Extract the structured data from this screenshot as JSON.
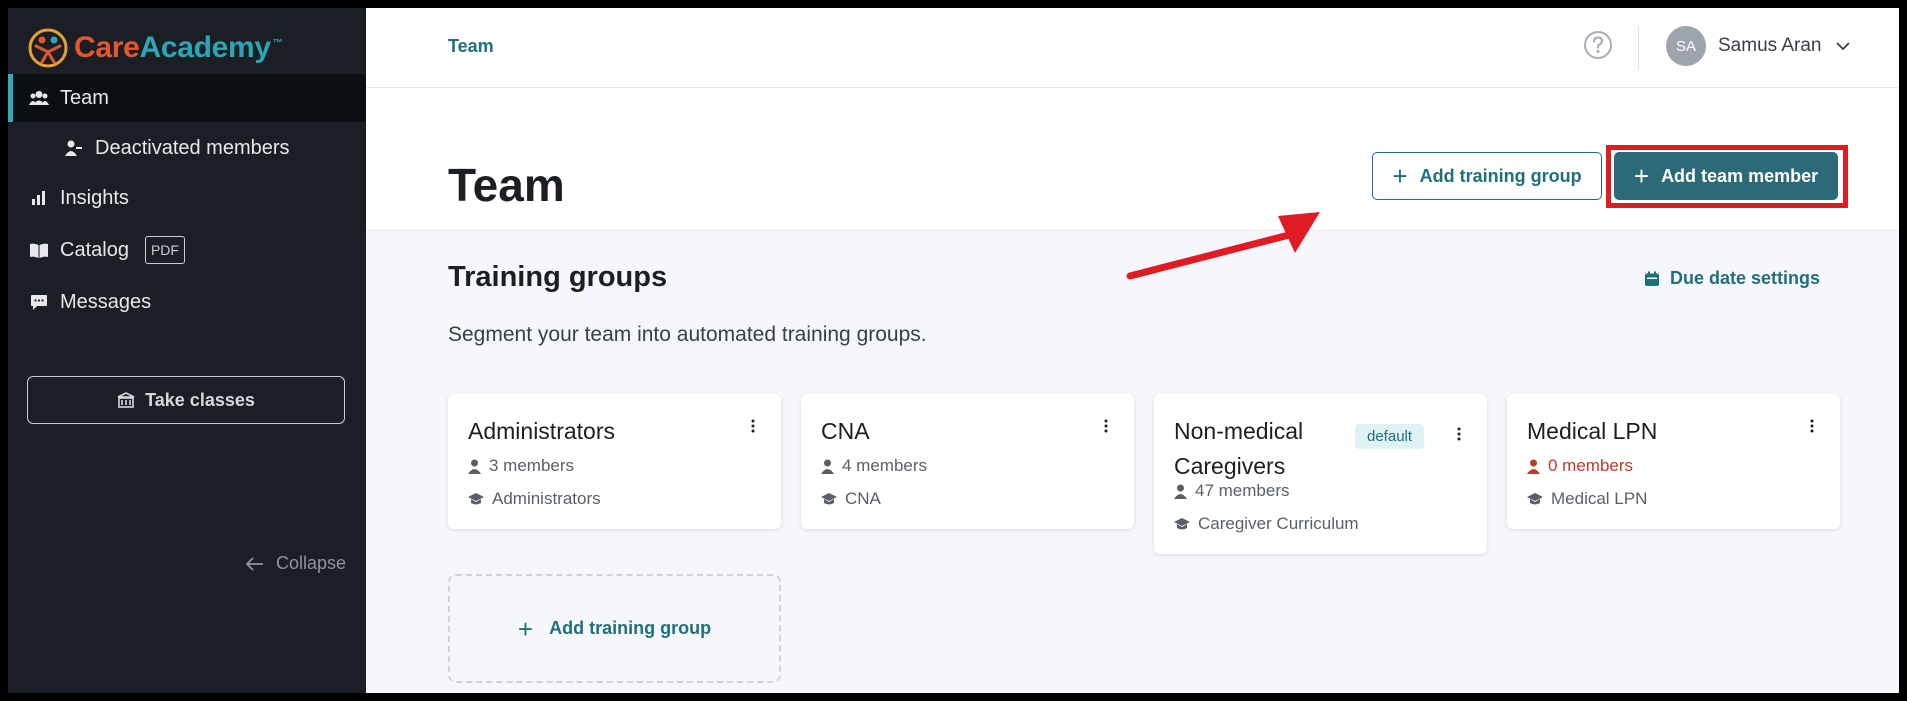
{
  "brand": {
    "care": "Care",
    "academy": "Academy",
    "tm": "™"
  },
  "sidebar": {
    "items": [
      {
        "label": "Team",
        "icon": "users-icon",
        "active": true
      },
      {
        "label": "Deactivated members",
        "icon": "user-minus-icon"
      },
      {
        "label": "Insights",
        "icon": "bar-chart-icon"
      },
      {
        "label": "Catalog",
        "icon": "book-icon",
        "badge": "PDF"
      },
      {
        "label": "Messages",
        "icon": "chat-icon"
      }
    ],
    "take_classes": "Take classes",
    "collapse": "Collapse"
  },
  "topbar": {
    "breadcrumb": "Team",
    "user": {
      "initials": "SA",
      "name": "Samus Aran"
    }
  },
  "header": {
    "title": "Team",
    "add_training_group": "Add training group",
    "add_team_member": "Add team member"
  },
  "training_groups": {
    "title": "Training groups",
    "description": "Segment your team into automated training groups.",
    "due_date_settings": "Due date settings",
    "cards": [
      {
        "name": "Administrators",
        "members": "3 members",
        "curriculum": "Administrators"
      },
      {
        "name": "CNA",
        "members": "4 members",
        "curriculum": "CNA"
      },
      {
        "name": "Non-medical Caregivers",
        "badge": "default",
        "members": "47 members",
        "curriculum": "Caregiver Curriculum"
      },
      {
        "name": "Medical LPN",
        "members": "0 members",
        "curriculum": "Medical LPN"
      }
    ],
    "add_group_label": "Add training group"
  },
  "colors": {
    "accent": "#2b6a76",
    "sidebar_bg": "#1b1f25",
    "annotation_red": "#e01b24",
    "warning": "#c0392b"
  }
}
